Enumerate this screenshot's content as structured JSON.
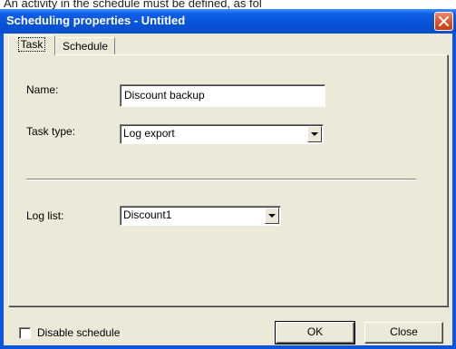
{
  "background_text": "An activity in the schedule must be defined, as fol",
  "window": {
    "title": "Scheduling properties - Untitled"
  },
  "tabs": [
    {
      "label": "Task",
      "active": true
    },
    {
      "label": "Schedule",
      "active": false
    }
  ],
  "task": {
    "name_label": "Name:",
    "name_value": "Discount backup",
    "task_type_label": "Task type:",
    "task_type_value": "Log export",
    "log_list_label": "Log list:",
    "log_list_value": "Discount1"
  },
  "footer": {
    "disable_schedule_label": "Disable schedule",
    "disable_schedule_checked": false,
    "ok_label": "OK",
    "close_label": "Close"
  },
  "colors": {
    "titlebar": "#0a56de",
    "dialog_face": "#ece9d8",
    "close_button": "#e0562f"
  }
}
